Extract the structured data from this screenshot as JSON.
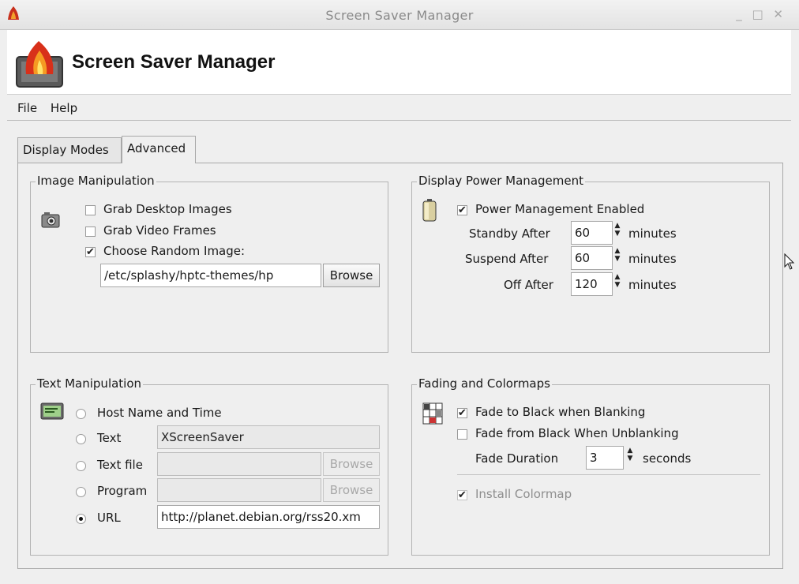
{
  "window": {
    "title": "Screen Saver Manager",
    "controls": "_ □ ✕"
  },
  "header": {
    "heading": "Screen Saver Manager",
    "logo_icon": "flame-icon"
  },
  "menu": {
    "file": "File",
    "help": "Help"
  },
  "tabs": [
    {
      "label": "Display Modes",
      "active": false
    },
    {
      "label": "Advanced",
      "active": true
    }
  ],
  "image_manipulation": {
    "title": "Image Manipulation",
    "icon": "camera-icon",
    "grab_desktop": {
      "label": "Grab Desktop Images",
      "checked": false
    },
    "grab_video": {
      "label": "Grab Video Frames",
      "checked": false
    },
    "choose_random": {
      "label": "Choose Random Image:",
      "checked": true
    },
    "path_value": "/etc/splashy/hptc-themes/hp",
    "browse_label": "Browse"
  },
  "power": {
    "title": "Display Power Management",
    "icon": "battery-icon",
    "enabled": {
      "label": "Power Management Enabled",
      "checked": true
    },
    "standby": {
      "label": "Standby After",
      "value": "60",
      "unit": "minutes"
    },
    "suspend": {
      "label": "Suspend After",
      "value": "60",
      "unit": "minutes"
    },
    "off": {
      "label": "Off After",
      "value": "120",
      "unit": "minutes"
    }
  },
  "text_manipulation": {
    "title": "Text Manipulation",
    "icon": "monitor-text-icon",
    "host_name": {
      "label": "Host Name and Time",
      "selected": false
    },
    "text": {
      "label": "Text",
      "value": "XScreenSaver",
      "selected": false
    },
    "text_file": {
      "label": "Text file",
      "value": "",
      "browse": "Browse",
      "selected": false
    },
    "program": {
      "label": "Program",
      "value": "",
      "browse": "Browse",
      "selected": false
    },
    "url": {
      "label": "URL",
      "value": "http://planet.debian.org/rss20.xm",
      "selected": true
    }
  },
  "fading": {
    "title": "Fading and Colormaps",
    "icon": "fade-grid-icon",
    "fade_to_black": {
      "label": "Fade to Black when Blanking",
      "checked": true
    },
    "fade_from_black": {
      "label": "Fade from Black When Unblanking",
      "checked": false
    },
    "duration": {
      "label": "Fade Duration",
      "value": "3",
      "unit": "seconds"
    },
    "install_colormap": {
      "label": "Install Colormap",
      "checked": true
    }
  }
}
